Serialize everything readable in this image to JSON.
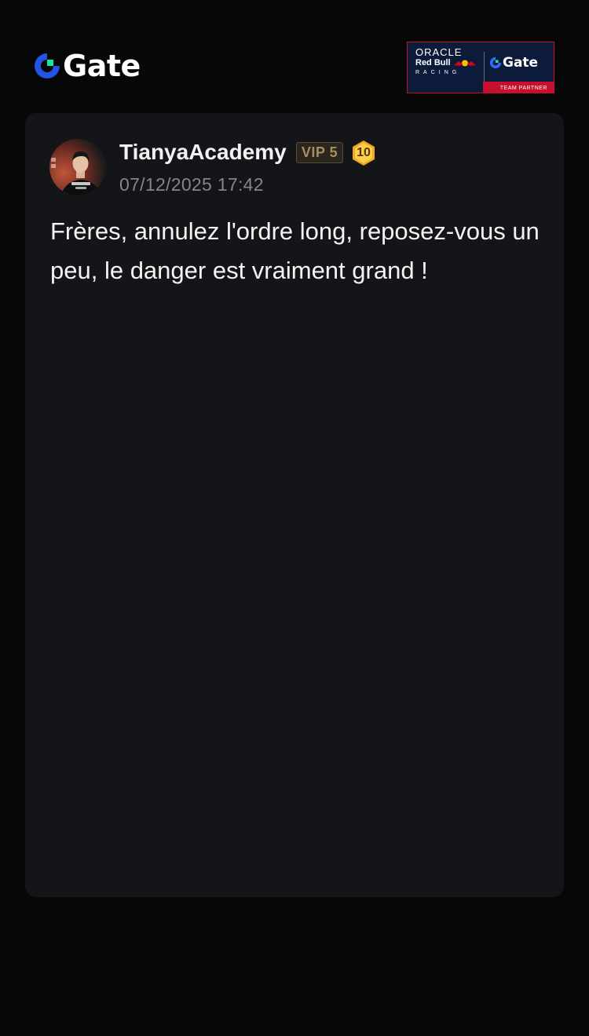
{
  "header": {
    "logo_text": "Gate",
    "logo_icon": "gate-logo-icon",
    "partner": {
      "oracle_text": "ORACLE",
      "redbull_text": "Red Bull",
      "racing_text": "RACING",
      "gate_text": "Gate",
      "strip_text": "TEAM PARTNER",
      "colors": {
        "navy": "#0d1b3a",
        "red": "#c8102e"
      }
    }
  },
  "post": {
    "author": "TianyaAcademy",
    "vip_label": "VIP 5",
    "level": "10",
    "timestamp": "07/12/2025 17:42",
    "body": "Frères, annulez l'ordre long, reposez-vous un peu, le danger est vraiment grand !",
    "avatar_icon": "user-avatar"
  },
  "colors": {
    "page_bg": "#070707",
    "card_bg": "#141518",
    "brand_blue": "#2354e6",
    "brand_green": "#17e6a1",
    "vip_gold": "#a98d62",
    "level_gold": "#f0a81e"
  }
}
